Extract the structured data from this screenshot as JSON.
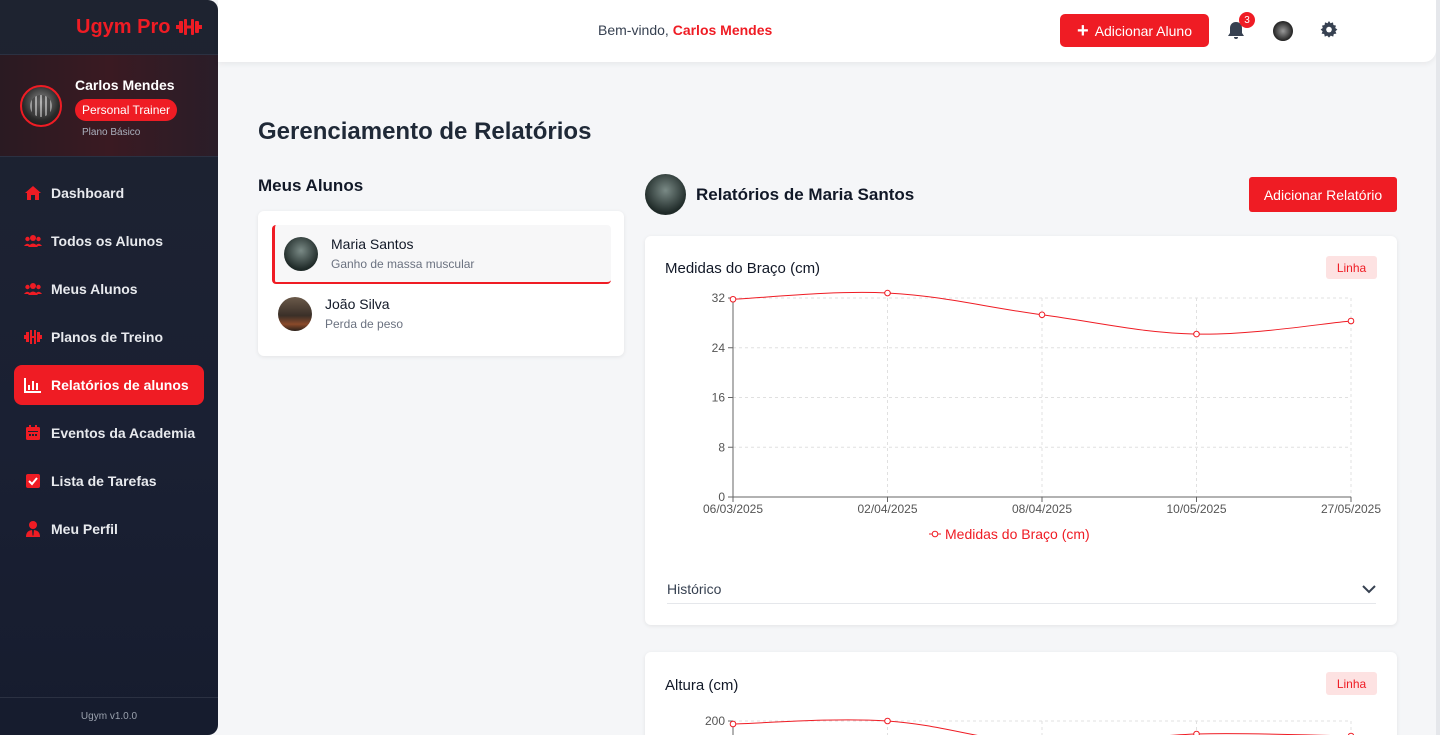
{
  "brand": {
    "name": "Ugym Pro",
    "icon": "dumbbell-icon"
  },
  "profile": {
    "name": "Carlos Mendes",
    "role": "Personal Trainer",
    "plan": "Plano Básico"
  },
  "nav": [
    {
      "label": "Dashboard",
      "icon": "home-icon",
      "active": false
    },
    {
      "label": "Todos os Alunos",
      "icon": "users-icon",
      "active": false
    },
    {
      "label": "Meus Alunos",
      "icon": "users-icon",
      "active": false
    },
    {
      "label": "Planos de Treino",
      "icon": "dumbbell-icon",
      "active": false
    },
    {
      "label": "Relatórios de alunos",
      "icon": "chart-bar-icon",
      "active": true
    },
    {
      "label": "Eventos da Academia",
      "icon": "calendar-icon",
      "active": false
    },
    {
      "label": "Lista de Tarefas",
      "icon": "check-square-icon",
      "active": false
    },
    {
      "label": "Meu Perfil",
      "icon": "user-tie-icon",
      "active": false
    }
  ],
  "version": "Ugym v1.0.0",
  "header": {
    "welcome": "Bem-vindo,",
    "user": "Carlos Mendes",
    "add_student": "Adicionar Aluno",
    "notifications": "3"
  },
  "main": {
    "title": "Gerenciamento de Relatórios",
    "students_title": "Meus Alunos",
    "students": [
      {
        "name": "Maria Santos",
        "goal": "Ganho de massa muscular",
        "active": true
      },
      {
        "name": "João Silva",
        "goal": "Perda de peso",
        "active": false
      }
    ],
    "reports_title": "Relatórios de Maria Santos",
    "add_report": "Adicionar Relatório",
    "history_label": "Histórico"
  },
  "colors": {
    "accent": "#ef1c24",
    "sidebar": "#1e2330"
  },
  "chart_data": [
    {
      "type": "line",
      "title": "Medidas do Braço (cm)",
      "badge": "Linha",
      "x": [
        "06/03/2025",
        "02/04/2025",
        "08/04/2025",
        "10/05/2025",
        "27/05/2025"
      ],
      "series": [
        {
          "name": "Medidas do Braço (cm)",
          "values": [
            31.8,
            32.8,
            29.3,
            26.2,
            28.3
          ]
        }
      ],
      "ylim": [
        0,
        32
      ],
      "yticks": [
        0,
        8,
        16,
        24,
        32
      ],
      "grid": true,
      "legend": "bottom"
    },
    {
      "type": "line",
      "title": "Altura (cm)",
      "badge": "Linha",
      "yticks": [
        200
      ],
      "partial": true
    }
  ]
}
